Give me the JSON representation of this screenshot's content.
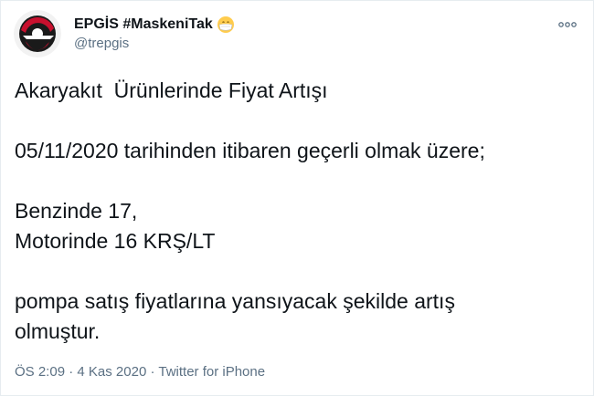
{
  "author": {
    "name": "EPGİS #MaskeniTak",
    "emoji": "mask-face-emoji",
    "handle": "@trepgis",
    "avatar": "epgis-logo"
  },
  "more_icon": "ellipsis-icon",
  "tweet": {
    "lines": [
      "Akaryakıt  Ürünlerinde Fiyat Artışı",
      "",
      "05/11/2020 tarihinden itibaren geçerli olmak üzere;",
      "",
      "Benzinde 17,",
      "Motorinde 16 KRŞ/LT",
      "",
      "pompa satış fiyatlarına yansıyacak şekilde artış",
      "olmuştur."
    ]
  },
  "meta": {
    "time": "ÖS 2:09",
    "sep1": " · ",
    "date": "4 Kas 2020",
    "sep2": " · ",
    "source": "Twitter for iPhone"
  },
  "colors": {
    "text": "#0f1419",
    "secondary": "#5b7083",
    "logo_red": "#c8102e",
    "logo_dark": "#1a1a1a"
  }
}
